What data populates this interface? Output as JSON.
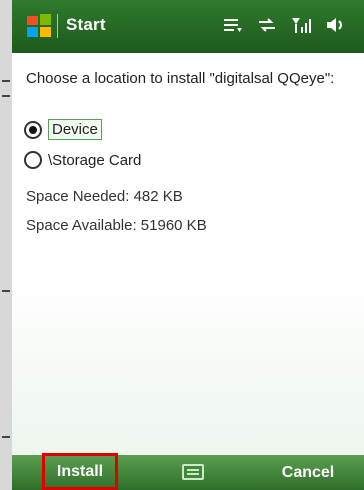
{
  "titlebar": {
    "title": "Start"
  },
  "dialog": {
    "prompt": "Choose a location to install \"digitalsal QQeye\":",
    "options": [
      {
        "label": "Device",
        "selected": true
      },
      {
        "label": "\\Storage Card",
        "selected": false
      }
    ],
    "space_needed": "Space Needed:  482 KB",
    "space_available": "Space Available: 51960 KB"
  },
  "softkeys": {
    "left": "Install",
    "right": "Cancel"
  },
  "colors": {
    "titlebar": "#1e5a1d",
    "softbar": "#2e6e2a",
    "highlight_box": "#e00000"
  },
  "icons": {
    "start": "windows-flag-icon",
    "status": [
      "settings-icon",
      "connectivity-icon",
      "signal-icon",
      "volume-icon"
    ],
    "keyboard": "keyboard-icon"
  }
}
